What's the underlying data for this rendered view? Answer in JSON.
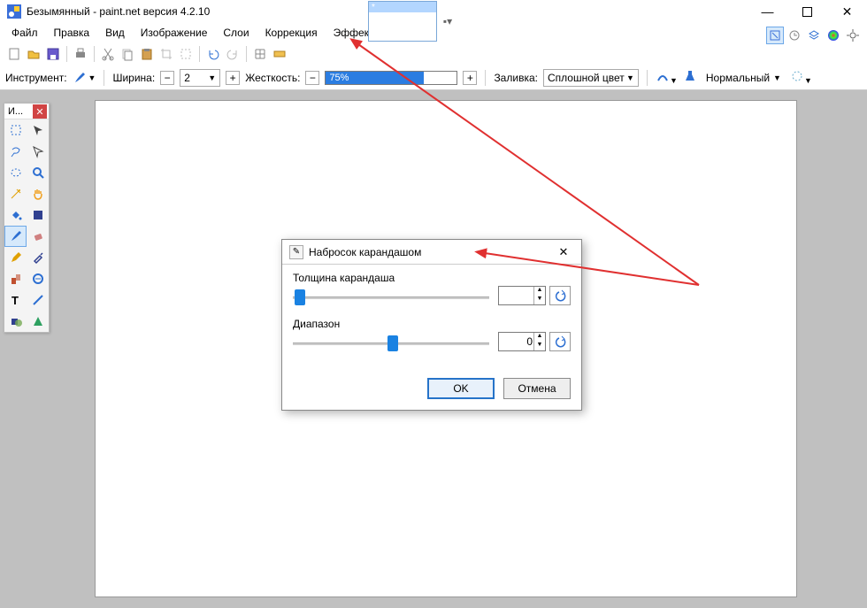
{
  "window": {
    "title": "Безымянный - paint.net версия 4.2.10"
  },
  "menu": {
    "items": [
      "Файл",
      "Правка",
      "Вид",
      "Изображение",
      "Слои",
      "Коррекция",
      "Эффекты"
    ]
  },
  "tooloptions": {
    "tool_label": "Инструмент:",
    "width_label": "Ширина:",
    "width_value": "2",
    "hardness_label": "Жесткость:",
    "hardness_value": "75%",
    "hardness_pct": 75,
    "fill_label": "Заливка:",
    "fill_value": "Сплошной цвет",
    "blend_value": "Нормальный"
  },
  "tools_window": {
    "title": "И..."
  },
  "dialog": {
    "title": "Набросок карандашом",
    "param1_label": "Толщина карандаша",
    "param1_value": "",
    "param2_label": "Диапазон",
    "param2_value": "0",
    "ok": "OK",
    "cancel": "Отмена"
  },
  "tools": [
    {
      "n": "rect-select",
      "c": "#2d6fd2"
    },
    {
      "n": "move-select",
      "c": "#444"
    },
    {
      "n": "lasso",
      "c": "#2d6fd2"
    },
    {
      "n": "move-selection",
      "c": "#444"
    },
    {
      "n": "ellipse-select",
      "c": "#2d6fd2"
    },
    {
      "n": "zoom",
      "c": "#2d6fd2"
    },
    {
      "n": "magic-wand",
      "c": "#e0a000"
    },
    {
      "n": "pan",
      "c": "#f0a020"
    },
    {
      "n": "fill",
      "c": "#2d6fd2"
    },
    {
      "n": "gradient",
      "c": "#304090"
    },
    {
      "n": "brush",
      "c": "#2d6fd2",
      "active": true
    },
    {
      "n": "eraser",
      "c": "#d08080"
    },
    {
      "n": "pencil",
      "c": "#e0a000"
    },
    {
      "n": "eyedropper",
      "c": "#304090"
    },
    {
      "n": "clone",
      "c": "#c05030"
    },
    {
      "n": "recolor",
      "c": "#2d6fd2"
    },
    {
      "n": "text",
      "c": "#000"
    },
    {
      "n": "line",
      "c": "#2d6fd2"
    },
    {
      "n": "shapes",
      "c": "#304090"
    },
    {
      "n": "shapes2",
      "c": "#2da060"
    }
  ]
}
